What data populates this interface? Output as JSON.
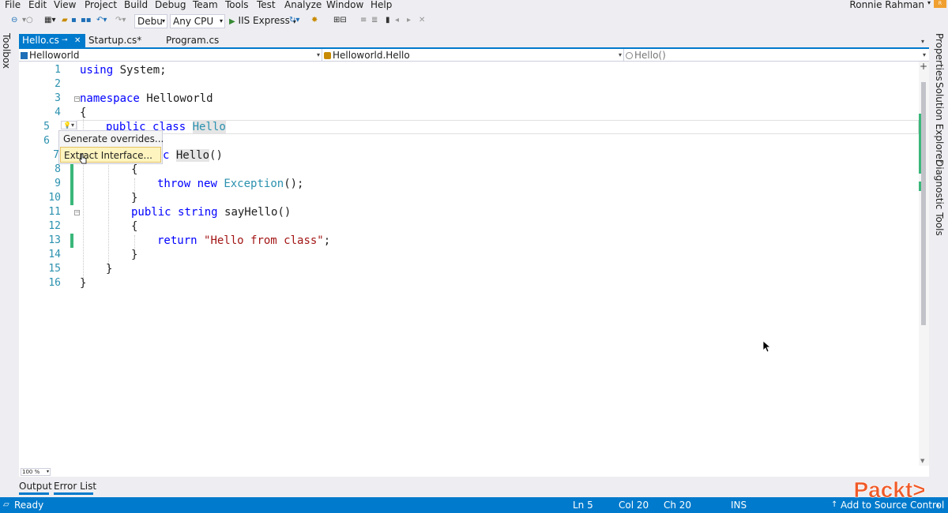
{
  "menu": {
    "items": [
      "File",
      "Edit",
      "View",
      "Project",
      "Build",
      "Debug",
      "Team",
      "Tools",
      "Test",
      "Analyze",
      "Window",
      "Help"
    ],
    "user_name": "Ronnie Rahman"
  },
  "toolbar": {
    "configuration": "Debu",
    "platform": "Any CPU",
    "run_target": "IIS Express"
  },
  "side_panels": {
    "toolbox": "Toolbox",
    "properties": "Properties",
    "solution_explorer": "Solution Explorer",
    "diagnostic_tools": "Diagnostic Tools"
  },
  "tabs": [
    {
      "label": "Hello.cs",
      "active": true
    },
    {
      "label": "Startup.cs*",
      "active": false
    },
    {
      "label": "Program.cs",
      "active": false
    }
  ],
  "navigation": {
    "project": "Helloworld",
    "type": "Helloworld.Hello",
    "member": "Hello()"
  },
  "editor": {
    "line_numbers": [
      "1",
      "2",
      "3",
      "4",
      "5",
      "6",
      "7",
      "8",
      "9",
      "10",
      "11",
      "12",
      "13",
      "14",
      "15",
      "16"
    ],
    "lines": {
      "l1_using": "using",
      "l1_rest": " System;",
      "l3_namespace": "namespace",
      "l3_rest": " Helloworld",
      "l4": "{",
      "l5_public": "public",
      "l5_class": "class",
      "l5_name": "Hello",
      "l7_frag": "c ",
      "l7_name": "Hello",
      "l7_rest": "()",
      "l8": "{",
      "l9_throw": "throw",
      "l9_new": "new",
      "l9_type": "Exception",
      "l9_rest": "();",
      "l10": "}",
      "l11_public": "public",
      "l11_string": "string",
      "l11_rest": " sayHello()",
      "l12": "{",
      "l13_return": "return",
      "l13_str": "\"Hello from class\"",
      "l13_rest": ";",
      "l14": "}",
      "l15": "}",
      "l16": "}"
    },
    "zoom": "100 %"
  },
  "quick_actions": {
    "items": [
      "Generate overrides...",
      "Extract Interface..."
    ]
  },
  "bottom_panel": {
    "tabs": [
      "Output",
      "Error List"
    ]
  },
  "status": {
    "ready": "Ready",
    "line": "Ln 5",
    "col": "Col 20",
    "ch": "Ch 20",
    "mode": "INS",
    "source_control": "Add to Source Control"
  },
  "logo": "Packt>",
  "colors": {
    "accent": "#007acc",
    "keyword": "#0000ff",
    "type": "#2b91af",
    "string": "#a31515",
    "change_bar": "#3ab77a",
    "logo": "#f05a28"
  }
}
